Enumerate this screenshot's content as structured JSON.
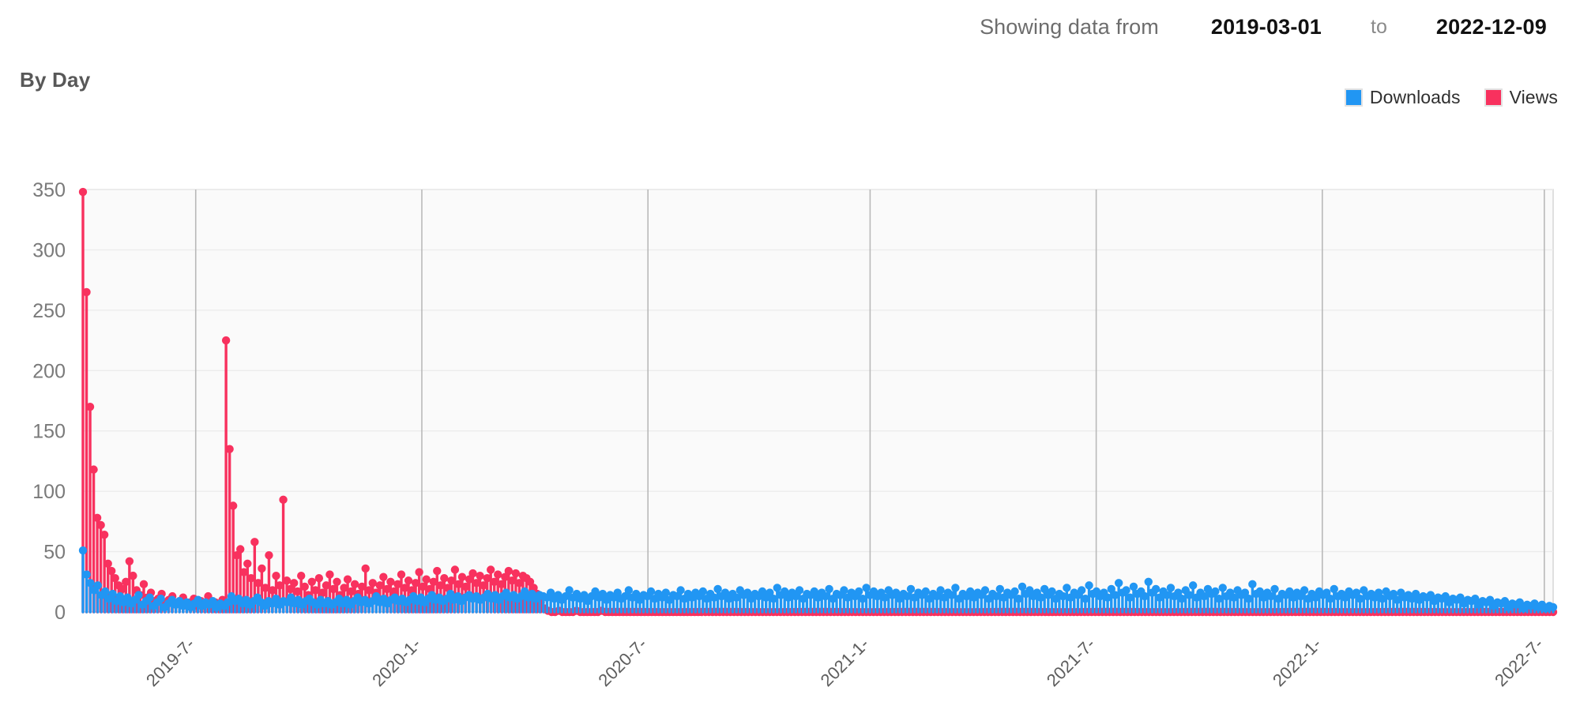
{
  "header": {
    "showing_label": "Showing data from",
    "date_from": "2019-03-01",
    "to_label": "to",
    "date_to": "2022-12-09"
  },
  "chart_title": "By Day",
  "legend": {
    "items": [
      {
        "label": "Downloads",
        "color": "#2196f3"
      },
      {
        "label": "Views",
        "color": "#f8315e"
      }
    ]
  },
  "colors": {
    "downloads": "#2196f3",
    "views": "#f8315e",
    "grid": "#d6d6d6",
    "plot_bg": "#fafafa",
    "axis_text": "#7a7a7a"
  },
  "chart_data": {
    "type": "line",
    "title": "By Day",
    "xlabel": "",
    "ylabel": "",
    "ylim": [
      0,
      350
    ],
    "grid": true,
    "legend_position": "top-right",
    "y_ticks": [
      0,
      50,
      100,
      150,
      200,
      250,
      300,
      350
    ],
    "x_ticks": [
      "2019-7-",
      "2020-1-",
      "2020-7-",
      "2021-1-",
      "2021-7-",
      "2022-1-",
      "2022-7-"
    ],
    "x_tick_positions": [
      0.0767,
      0.2305,
      0.3843,
      0.5354,
      0.6892,
      0.843,
      0.994
    ],
    "x_range": [
      "2019-03-01",
      "2022-12-09"
    ],
    "n_points": 380,
    "series": [
      {
        "name": "Views",
        "color": "#f8315e",
        "values": [
          348,
          265,
          170,
          118,
          78,
          72,
          64,
          40,
          34,
          28,
          22,
          19,
          25,
          42,
          30,
          18,
          14,
          23,
          12,
          16,
          9,
          11,
          15,
          8,
          10,
          13,
          7,
          9,
          12,
          6,
          8,
          11,
          5,
          9,
          7,
          13,
          6,
          8,
          5,
          10,
          225,
          135,
          88,
          47,
          52,
          33,
          40,
          28,
          58,
          24,
          36,
          20,
          47,
          18,
          30,
          22,
          93,
          26,
          19,
          24,
          17,
          30,
          21,
          14,
          25,
          18,
          28,
          16,
          22,
          31,
          19,
          25,
          14,
          20,
          27,
          17,
          23,
          15,
          21,
          36,
          18,
          24,
          16,
          22,
          29,
          19,
          25,
          17,
          23,
          31,
          20,
          26,
          18,
          24,
          33,
          21,
          27,
          19,
          25,
          34,
          22,
          28,
          20,
          26,
          35,
          23,
          29,
          21,
          27,
          32,
          24,
          30,
          22,
          28,
          35,
          25,
          31,
          23,
          29,
          34,
          26,
          32,
          24,
          30,
          28,
          25,
          20,
          15,
          8,
          3,
          1,
          0,
          0,
          1,
          0,
          0,
          0,
          0,
          1,
          0,
          0,
          0,
          0,
          0,
          0,
          1,
          0,
          0,
          0,
          0,
          0,
          0,
          0,
          0,
          0,
          0,
          0,
          0,
          0,
          0,
          0,
          0,
          0,
          0,
          0,
          0,
          0,
          0,
          0,
          0,
          0,
          0,
          0,
          0,
          0,
          0,
          0,
          0,
          0,
          0,
          0,
          0,
          0,
          0,
          0,
          0,
          0,
          0,
          0,
          0,
          0,
          0,
          0,
          0,
          0,
          0,
          0,
          0,
          0,
          0,
          0,
          0,
          0,
          0,
          0,
          0,
          0,
          0,
          0,
          0,
          0,
          0,
          0,
          0,
          0,
          0,
          0,
          0,
          0,
          0,
          0,
          0,
          0,
          0,
          0,
          0,
          0,
          0,
          0,
          0,
          0,
          0,
          0,
          0,
          0,
          0,
          0,
          0,
          0,
          0,
          0,
          0,
          0,
          0,
          0,
          0,
          0,
          0,
          0,
          0,
          0,
          0,
          0,
          0,
          0,
          0,
          0,
          0,
          0,
          0,
          0,
          0,
          0,
          0,
          0,
          0,
          0,
          0,
          0,
          0,
          0,
          0,
          0,
          0,
          0,
          0,
          0,
          0,
          0,
          0,
          0,
          0,
          0,
          0,
          0,
          0,
          0,
          0,
          0,
          0,
          0,
          0,
          0,
          0,
          0,
          0,
          0,
          0,
          0,
          0,
          0,
          0,
          0,
          0,
          0,
          0,
          0,
          0,
          0,
          0,
          0,
          0,
          0,
          0,
          0,
          0,
          0,
          0,
          0,
          0,
          0,
          0,
          0,
          0,
          0,
          0,
          0,
          0,
          0,
          0,
          0,
          0,
          0,
          0,
          0,
          0,
          0,
          0,
          0,
          0,
          0,
          0,
          0,
          0,
          0,
          0,
          0,
          0,
          0,
          0,
          0,
          0,
          0,
          0,
          0,
          0,
          0,
          0,
          0,
          0,
          0,
          0,
          0,
          0,
          0,
          0,
          0,
          0,
          0,
          0,
          0,
          0,
          0,
          0,
          0,
          0,
          0,
          0,
          0,
          0,
          0,
          0,
          0,
          0,
          0,
          0,
          0,
          0,
          0,
          0,
          0,
          0,
          0,
          0,
          0,
          0,
          0,
          0,
          0,
          0,
          0,
          0,
          0,
          0,
          0,
          0,
          0,
          0,
          0,
          0,
          0,
          0
        ]
      },
      {
        "name": "Downloads",
        "color": "#2196f3",
        "values": [
          51,
          31,
          24,
          18,
          22,
          14,
          17,
          11,
          15,
          9,
          13,
          8,
          12,
          7,
          10,
          14,
          6,
          9,
          12,
          5,
          8,
          11,
          4,
          7,
          10,
          6,
          9,
          5,
          8,
          4,
          7,
          10,
          5,
          8,
          6,
          9,
          4,
          7,
          5,
          8,
          13,
          9,
          11,
          7,
          10,
          6,
          9,
          12,
          8,
          5,
          9,
          7,
          11,
          6,
          9,
          8,
          12,
          7,
          10,
          6,
          9,
          11,
          8,
          6,
          10,
          7,
          9,
          6,
          8,
          11,
          7,
          10,
          6,
          9,
          12,
          8,
          10,
          7,
          9,
          13,
          8,
          11,
          7,
          10,
          12,
          9,
          11,
          8,
          10,
          13,
          9,
          12,
          8,
          11,
          14,
          10,
          12,
          9,
          11,
          15,
          10,
          13,
          9,
          12,
          14,
          11,
          13,
          10,
          12,
          15,
          11,
          14,
          10,
          13,
          16,
          12,
          14,
          11,
          13,
          17,
          12,
          15,
          11,
          14,
          13,
          12,
          16,
          11,
          14,
          10,
          13,
          18,
          12,
          15,
          11,
          14,
          9,
          13,
          17,
          12,
          15,
          10,
          14,
          12,
          16,
          11,
          13,
          18,
          12,
          15,
          10,
          14,
          13,
          17,
          11,
          15,
          12,
          16,
          10,
          14,
          13,
          18,
          11,
          15,
          12,
          16,
          13,
          17,
          11,
          15,
          12,
          19,
          13,
          16,
          11,
          15,
          12,
          18,
          14,
          16,
          11,
          15,
          13,
          17,
          12,
          16,
          11,
          20,
          14,
          17,
          12,
          16,
          13,
          18,
          11,
          15,
          14,
          17,
          12,
          16,
          13,
          19,
          11,
          15,
          14,
          18,
          12,
          16,
          13,
          17,
          11,
          20,
          14,
          17,
          13,
          16,
          12,
          18,
          14,
          16,
          11,
          15,
          13,
          19,
          12,
          16,
          14,
          17,
          11,
          15,
          13,
          18,
          12,
          16,
          14,
          20,
          11,
          15,
          13,
          17,
          12,
          16,
          14,
          18,
          11,
          15,
          13,
          19,
          12,
          16,
          14,
          17,
          11,
          21,
          15,
          18,
          13,
          16,
          12,
          19,
          14,
          17,
          11,
          15,
          13,
          20,
          12,
          16,
          14,
          18,
          11,
          22,
          15,
          17,
          13,
          16,
          12,
          19,
          14,
          24,
          16,
          18,
          12,
          21,
          15,
          17,
          13,
          25,
          16,
          19,
          12,
          17,
          14,
          20,
          13,
          16,
          11,
          18,
          14,
          22,
          12,
          16,
          13,
          19,
          15,
          17,
          11,
          20,
          13,
          16,
          12,
          18,
          14,
          16,
          11,
          23,
          15,
          17,
          12,
          16,
          13,
          19,
          11,
          15,
          14,
          17,
          12,
          16,
          13,
          18,
          11,
          15,
          12,
          17,
          14,
          16,
          11,
          19,
          13,
          15,
          12,
          17,
          14,
          16,
          11,
          18,
          13,
          15,
          12,
          16,
          11,
          17,
          13,
          15,
          10,
          16,
          12,
          14,
          11,
          15,
          10,
          13,
          12,
          14,
          9,
          12,
          11,
          13,
          8,
          11,
          10,
          12,
          7,
          10,
          9,
          11,
          6,
          9,
          8,
          10,
          5,
          8,
          7,
          9,
          4,
          7,
          6,
          8,
          3,
          6,
          5,
          7,
          4,
          6,
          3,
          5,
          4
        ]
      }
    ]
  }
}
